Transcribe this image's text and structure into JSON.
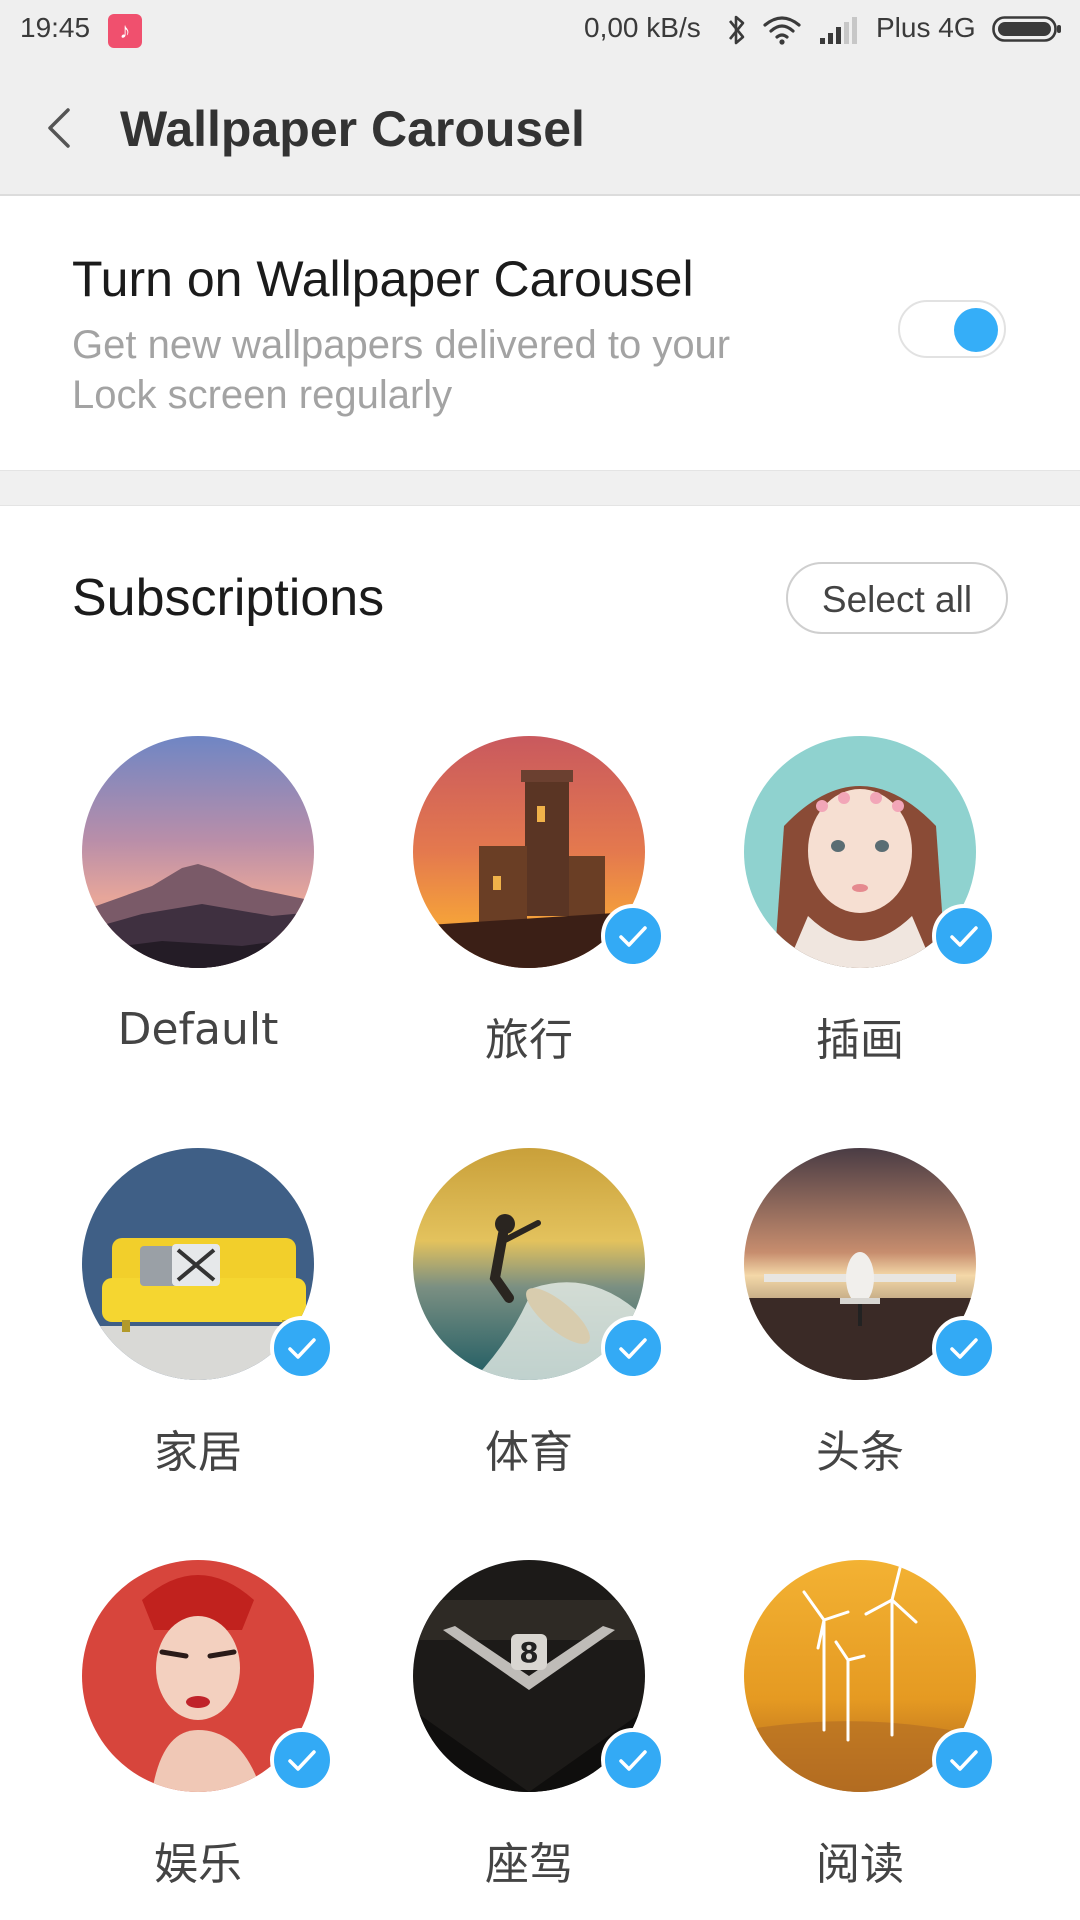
{
  "status_bar": {
    "time": "19:45",
    "network_speed": "0,00 kB/s",
    "carrier": "Plus 4G",
    "music_glyph": "♪"
  },
  "header": {
    "back_icon": "chevron-left-icon",
    "title": "Wallpaper Carousel"
  },
  "carousel_toggle": {
    "title": "Turn on Wallpaper Carousel",
    "subtitle": "Get new wallpapers delivered to your Lock screen regularly",
    "enabled": true
  },
  "subscriptions": {
    "title": "Subscriptions",
    "select_all_label": "Select all",
    "items": [
      {
        "label": "Default",
        "checked": false
      },
      {
        "label": "旅行",
        "checked": true
      },
      {
        "label": "插画",
        "checked": true
      },
      {
        "label": "家居",
        "checked": true
      },
      {
        "label": "体育",
        "checked": true
      },
      {
        "label": "头条",
        "checked": true
      },
      {
        "label": "娱乐",
        "checked": true
      },
      {
        "label": "座驾",
        "checked": true
      },
      {
        "label": "阅读",
        "checked": true
      }
    ]
  },
  "colors": {
    "accent": "#35aef8",
    "header_bg": "#efefef",
    "text_primary": "#1b1b1b",
    "text_secondary": "#a3a3a3"
  }
}
